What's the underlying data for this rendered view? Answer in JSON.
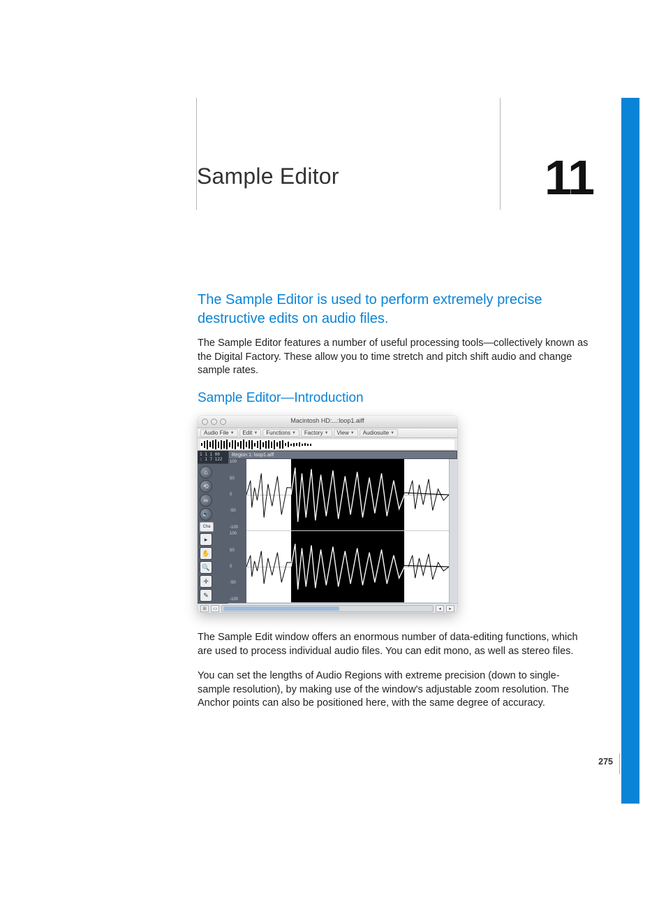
{
  "chapter": {
    "title": "Sample Editor",
    "number": "11"
  },
  "intro_blue": "The Sample Editor is used to perform extremely precise destructive edits on audio files.",
  "body1": "The Sample Editor features a number of useful processing tools—collectively known as the Digital Factory. These allow you to time stretch and pitch shift audio and change sample rates.",
  "section_head": "Sample Editor—Introduction",
  "body2": "The Sample Edit window offers an enormous number of data-editing functions, which are used to process individual audio files. You can edit mono, as well as stereo files.",
  "body3": "You can set the lengths of Audio Regions with extreme precision (down to single-sample resolution), by making use of the window's adjustable zoom resolution. The Anchor points can also be positioned here, with the same degree of accuracy.",
  "page_number": "275",
  "figure": {
    "window_title": "Macintosh HD:...:loop1.aiff",
    "menus": [
      "Audio File",
      "Edit",
      "Functions",
      "Factory",
      "View",
      "Audiosuite"
    ],
    "counter_line1": "1  1  1  00",
    "counter_line2": ":   1   7 122",
    "region_label": "Region 1: loop1.aiff",
    "cha_label": "Cha",
    "axis_ticks": [
      "100",
      "50",
      "0",
      "-50",
      "-100"
    ],
    "tool_icons": [
      "home-icon",
      "loop-icon",
      "link-icon",
      "speaker-icon",
      "pointer-icon",
      "hand-icon",
      "zoom-icon",
      "crosshair-icon",
      "pencil-icon"
    ],
    "zoom_glyph": "⊞"
  }
}
